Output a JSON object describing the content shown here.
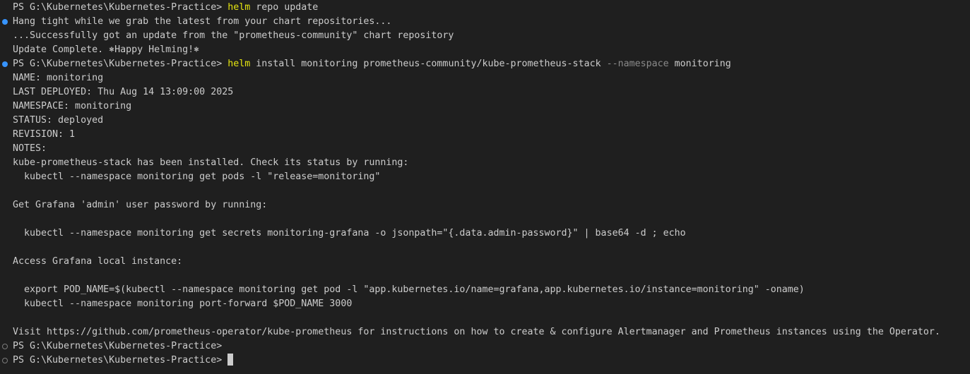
{
  "terminal": {
    "colors": {
      "background": "#1f1f1f",
      "text": "#cccccc",
      "command": "#e5e510",
      "parameter": "#8a8a8a",
      "success_dot": "#3794ff",
      "idle_dot": "#7a7a7a"
    },
    "lines": [
      {
        "deco": "none",
        "segs": [
          {
            "t": "PS G:\\Kubernetes\\Kubernetes-Practice> "
          },
          {
            "t": "helm",
            "c": "cmd"
          },
          {
            "t": " repo update"
          }
        ]
      },
      {
        "deco": "ok",
        "segs": [
          {
            "t": "Hang tight while we grab the latest from your chart repositories..."
          }
        ]
      },
      {
        "deco": "none",
        "segs": [
          {
            "t": "...Successfully got an update from the \"prometheus-community\" chart repository"
          }
        ]
      },
      {
        "deco": "none",
        "segs": [
          {
            "t": "Update Complete. ⎈Happy Helming!⎈"
          }
        ]
      },
      {
        "deco": "ok",
        "segs": [
          {
            "t": "PS G:\\Kubernetes\\Kubernetes-Practice> "
          },
          {
            "t": "helm",
            "c": "cmd"
          },
          {
            "t": " install monitoring prometheus-community/kube-prometheus-stack "
          },
          {
            "t": "--namespace",
            "c": "param"
          },
          {
            "t": " monitoring"
          }
        ]
      },
      {
        "deco": "none",
        "segs": [
          {
            "t": "NAME: monitoring"
          }
        ]
      },
      {
        "deco": "none",
        "segs": [
          {
            "t": "LAST DEPLOYED: Thu Aug 14 13:09:00 2025"
          }
        ]
      },
      {
        "deco": "none",
        "segs": [
          {
            "t": "NAMESPACE: monitoring"
          }
        ]
      },
      {
        "deco": "none",
        "segs": [
          {
            "t": "STATUS: deployed"
          }
        ]
      },
      {
        "deco": "none",
        "segs": [
          {
            "t": "REVISION: 1"
          }
        ]
      },
      {
        "deco": "none",
        "segs": [
          {
            "t": "NOTES:"
          }
        ]
      },
      {
        "deco": "none",
        "segs": [
          {
            "t": "kube-prometheus-stack has been installed. Check its status by running:"
          }
        ]
      },
      {
        "deco": "none",
        "segs": [
          {
            "t": "  kubectl --namespace monitoring get pods -l \"release=monitoring\""
          }
        ]
      },
      {
        "deco": "none",
        "segs": []
      },
      {
        "deco": "none",
        "segs": [
          {
            "t": "Get Grafana 'admin' user password by running:"
          }
        ]
      },
      {
        "deco": "none",
        "segs": []
      },
      {
        "deco": "none",
        "segs": [
          {
            "t": "  kubectl --namespace monitoring get secrets monitoring-grafana -o jsonpath=\"{.data.admin-password}\" | base64 -d ; echo"
          }
        ]
      },
      {
        "deco": "none",
        "segs": []
      },
      {
        "deco": "none",
        "segs": [
          {
            "t": "Access Grafana local instance:"
          }
        ]
      },
      {
        "deco": "none",
        "segs": []
      },
      {
        "deco": "none",
        "segs": [
          {
            "t": "  export POD_NAME=$(kubectl --namespace monitoring get pod -l \"app.kubernetes.io/name=grafana,app.kubernetes.io/instance=monitoring\" -oname)"
          }
        ]
      },
      {
        "deco": "none",
        "segs": [
          {
            "t": "  kubectl --namespace monitoring port-forward $POD_NAME 3000"
          }
        ]
      },
      {
        "deco": "none",
        "segs": []
      },
      {
        "deco": "none",
        "segs": [
          {
            "t": "Visit https://github.com/prometheus-operator/kube-prometheus for instructions on how to create & configure Alertmanager and Prometheus instances using the Operator."
          }
        ]
      },
      {
        "deco": "idle",
        "segs": [
          {
            "t": "PS G:\\Kubernetes\\Kubernetes-Practice> "
          }
        ]
      },
      {
        "deco": "idle",
        "cursor": true,
        "segs": [
          {
            "t": "PS G:\\Kubernetes\\Kubernetes-Practice> "
          }
        ]
      }
    ]
  }
}
